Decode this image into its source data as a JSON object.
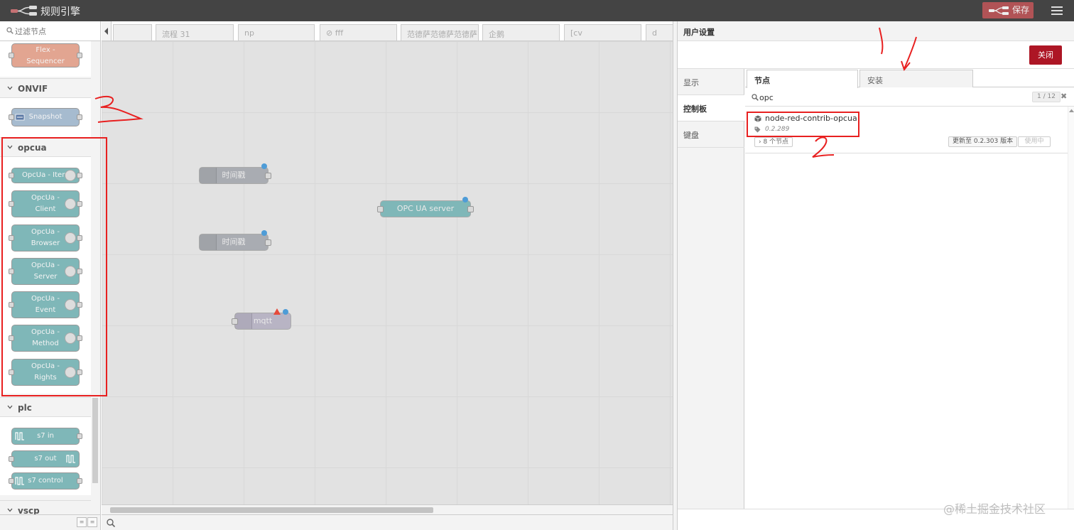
{
  "header": {
    "title": "规则引擎",
    "deploy_label": "保存"
  },
  "palette": {
    "search_placeholder": "过滤节点",
    "flex_node": "Flex - Sequencer",
    "categories": {
      "onvif": {
        "label": "ONVIF",
        "nodes": [
          "Snapshot"
        ]
      },
      "opcua": {
        "label": "opcua",
        "nodes": [
          "OpcUa - Item",
          "OpcUa - Client",
          "OpcUa - Browser",
          "OpcUa - Server",
          "OpcUa - Event",
          "OpcUa - Method",
          "OpcUa - Rights"
        ]
      },
      "plc": {
        "label": "plc",
        "nodes": [
          "s7 in",
          "s7 out",
          "s7 control"
        ]
      },
      "vscp": {
        "label": "vscp"
      }
    }
  },
  "tabs": [
    "",
    "流程 31",
    "np",
    "⊘ fff",
    "范德萨范德萨范德萨",
    "企鹅",
    "[cv",
    "d"
  ],
  "flow_nodes": {
    "inject1": "时间戳",
    "inject2": "时间戳",
    "opcua_server": "OPC UA server",
    "mqtt": "mqtt"
  },
  "settings": {
    "title": "用户设置",
    "close_label": "关闭",
    "nav": [
      "显示",
      "控制板",
      "键盘"
    ],
    "tabs": [
      "节点",
      "安装"
    ],
    "filter_value": "opc",
    "filter_count": "1 / 12",
    "clear_icon": "✖",
    "package": {
      "name": "node-red-contrib-opcua",
      "version": "0.2.289",
      "nodes_label": "8 个节点",
      "update_label": "更新至 0.2.303 版本",
      "in_use_label": "使用中"
    }
  },
  "annotations": {
    "one": "1",
    "two": "2",
    "three": "3"
  },
  "watermark": "@稀土掘金技术社区",
  "colors": {
    "header_bg": "#444444",
    "deploy": "#b15356",
    "close": "#ad1625",
    "opcua_node": "#7fb7b8",
    "annotation": "#e82020"
  }
}
